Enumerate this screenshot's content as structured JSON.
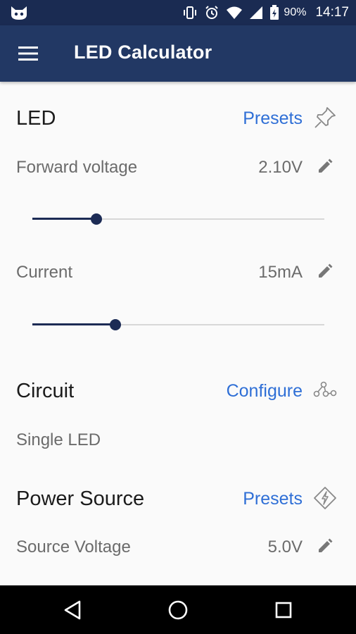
{
  "status_bar": {
    "battery_percent": "90%",
    "time": "14:17",
    "icons": [
      "cat-app-icon",
      "vibrate-icon",
      "alarm-icon",
      "wifi-icon",
      "signal-icon",
      "battery-icon"
    ]
  },
  "app_bar": {
    "title": "LED Calculator",
    "menu_icon": "hamburger-menu-icon"
  },
  "led": {
    "title": "LED",
    "presets_label": "Presets",
    "presets_icon": "pin-icon",
    "forward_voltage": {
      "label": "Forward voltage",
      "value": "2.10V",
      "slider_fraction": 0.22
    },
    "current": {
      "label": "Current",
      "value": "15mA",
      "slider_fraction": 0.285
    }
  },
  "circuit": {
    "title": "Circuit",
    "configure_label": "Configure",
    "configure_icon": "circuit-nodes-icon",
    "value": "Single LED"
  },
  "power_source": {
    "title": "Power Source",
    "presets_label": "Presets",
    "presets_icon": "power-diamond-icon",
    "source_voltage": {
      "label": "Source Voltage",
      "value": "5.0V"
    }
  },
  "nav_bar": {
    "buttons": [
      "back-icon",
      "home-icon",
      "recents-icon"
    ]
  },
  "colors": {
    "status_bar": "#1a2b52",
    "app_bar": "#223864",
    "accent_link": "#2f6fd6",
    "slider": "#1c2b55"
  }
}
